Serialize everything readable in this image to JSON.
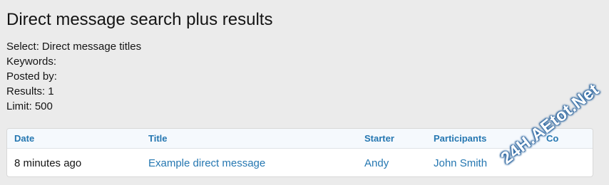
{
  "page": {
    "title": "Direct message search plus results"
  },
  "criteria": [
    {
      "label": "Select:",
      "value": "Direct message titles"
    },
    {
      "label": "Keywords:",
      "value": ""
    },
    {
      "label": "Posted by:",
      "value": ""
    },
    {
      "label": "Results:",
      "value": "1"
    },
    {
      "label": "Limit:",
      "value": "500"
    }
  ],
  "table": {
    "headers": {
      "date": "Date",
      "title": "Title",
      "starter": "Starter",
      "participants": "Participants",
      "count": "Co"
    },
    "rows": [
      {
        "date": "8 minutes ago",
        "title": "Example direct message",
        "starter": "Andy",
        "participants": "John Smith",
        "count": ""
      }
    ]
  },
  "watermark": {
    "text": "24H.AEtot.Net"
  },
  "colors": {
    "link": "#2577b1",
    "background": "#ebebeb",
    "header_bg": "#f5f9fd"
  }
}
